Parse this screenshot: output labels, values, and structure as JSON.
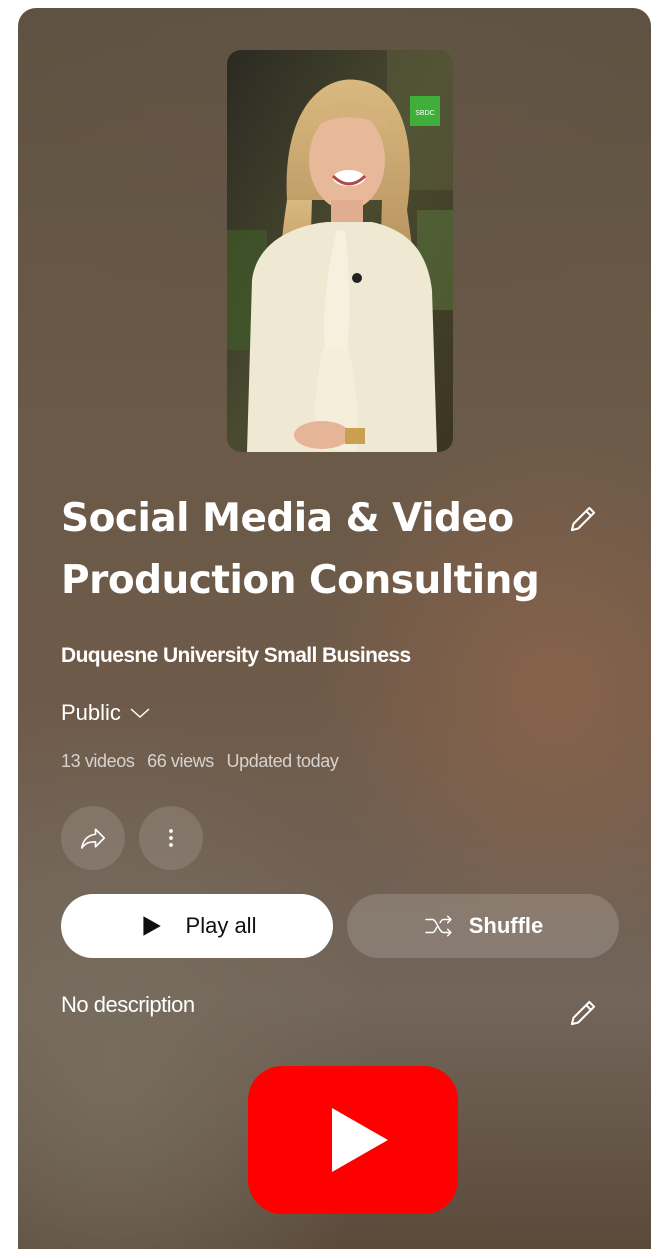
{
  "playlist": {
    "title": "Social Media & Video Production Consulting",
    "owner": "Duquesne University Small Business",
    "privacy": "Public",
    "stats": {
      "videos": "13 videos",
      "views": "66 views",
      "updated": "Updated today"
    },
    "play_all_label": "Play all",
    "shuffle_label": "Shuffle",
    "description": "No description",
    "thumbnail_badge": "SBDC"
  },
  "icons": {
    "edit_title": "pencil-icon",
    "privacy_dropdown": "chevron-down-icon",
    "share": "share-icon",
    "more": "more-vert-icon",
    "play": "play-icon",
    "shuffle": "shuffle-icon",
    "edit_description": "pencil-icon",
    "logo": "youtube-logo"
  },
  "colors": {
    "youtube_red": "#ff0000",
    "play_button_bg": "#ffffff",
    "text": "#ffffff"
  }
}
